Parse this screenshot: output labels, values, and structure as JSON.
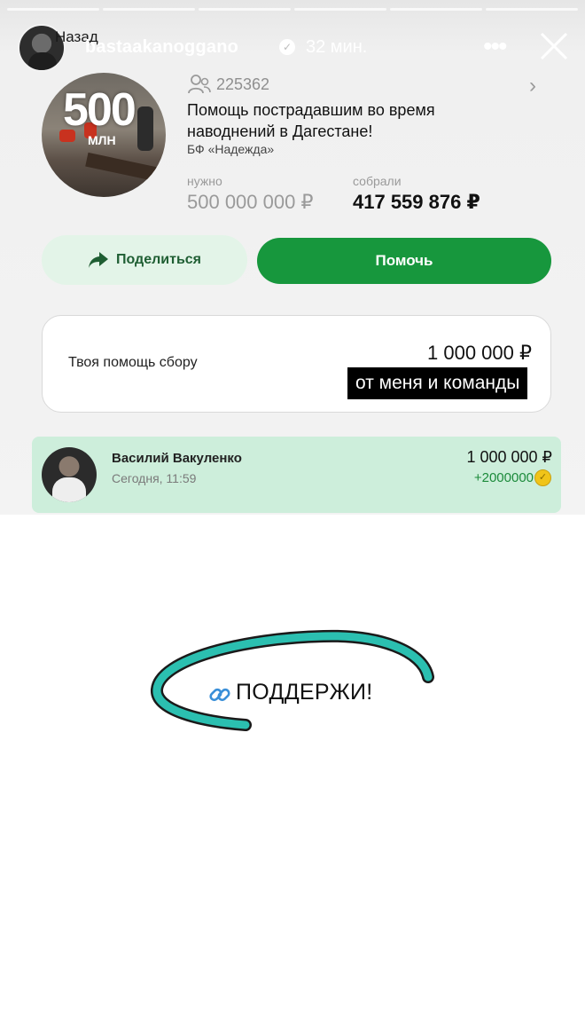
{
  "story": {
    "segments": 6,
    "back_label": "Назад",
    "username": "bastaakanoggano",
    "time_ago": "32 мин.",
    "icons": {
      "more": "more-dots-icon",
      "close": "close-icon",
      "verified": "verified-badge-icon"
    }
  },
  "fundraiser": {
    "image_text": "500",
    "image_subtext": "МЛН",
    "supporters": "225362",
    "title": "Помощь пострадавшим во время наводнений в Дагестане!",
    "organization": "БФ «Надежда»",
    "need_label": "нужно",
    "need_value": "500 000 000 ₽",
    "raised_label": "собрали",
    "raised_value": "417 559 876 ₽",
    "share_label": "Поделиться",
    "help_label": "Помочь"
  },
  "contribution": {
    "label": "Твоя помощь сбору",
    "amount": "1 000 000 ₽",
    "sticker": "от меня и команды"
  },
  "donor": {
    "name": "Василий Вакуленко",
    "time": "Сегодня, 11:59",
    "amount": "1 000 000 ₽",
    "bonus": "+2000000"
  },
  "call_to_action": {
    "text": "ПОДДЕРЖИ!"
  },
  "colors": {
    "primary_green": "#17973d",
    "share_bg": "#e3f4e8",
    "donor_bg": "#cdeedb",
    "scribble": "#2bbfb0"
  }
}
